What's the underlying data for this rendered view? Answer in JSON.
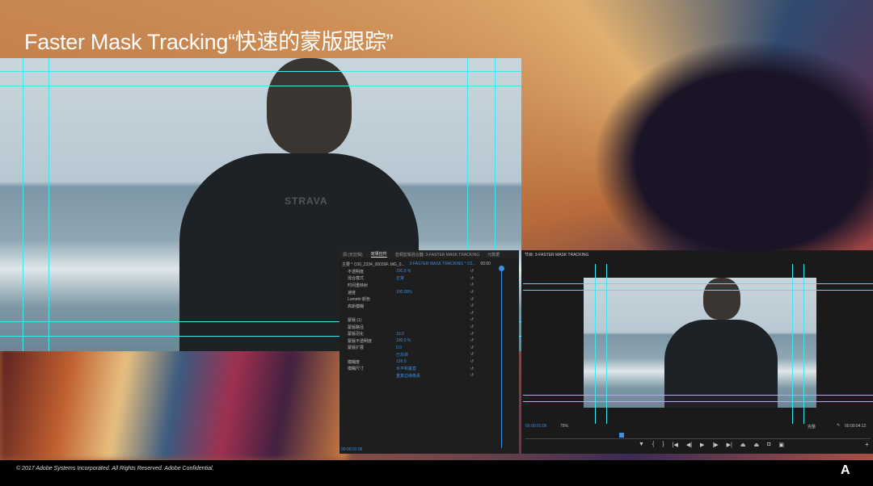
{
  "slide": {
    "title": "Faster Mask Tracking“快速的蒙版跟踪”"
  },
  "effect_controls": {
    "tabs": [
      "源:(无剪辑)",
      "效果控件",
      "音频剪辑混合器: 3-FASTER MASK TRACKING",
      "元数据"
    ],
    "clip_source": "主要 * C00_2334_00039F..MG_0...",
    "clip_target": "3-FASTER MASK TRACKING * C0...",
    "time": "00:00",
    "rows": [
      {
        "label": "不透明度",
        "value": "100.0 %"
      },
      {
        "label": "混合模式",
        "value": "正常"
      },
      {
        "label": "时间重映射",
        "value": ""
      },
      {
        "label": "速度",
        "value": "100.00%"
      },
      {
        "label": "Lumetri 颜色",
        "value": ""
      },
      {
        "label": "高斯模糊",
        "value": ""
      },
      {
        "label": "",
        "value": ""
      },
      {
        "label": "蒙版 (1)",
        "value": ""
      },
      {
        "label": "蒙版路径",
        "value": ""
      },
      {
        "label": "蒙版羽化",
        "value": "10.0"
      },
      {
        "label": "蒙版不透明度",
        "value": "100.0 %"
      },
      {
        "label": "蒙版扩展",
        "value": "0.0"
      },
      {
        "label": "",
        "value": "已反转"
      },
      {
        "label": "模糊度",
        "value": "126.0"
      },
      {
        "label": "模糊尺寸",
        "value": "水平和垂直"
      },
      {
        "label": "",
        "value": "重复边缘像素"
      }
    ],
    "bottom_time": "00:00:01:06"
  },
  "program_monitor": {
    "title": "节目: 3-FASTER MASK TRACKING",
    "timecode": "00:00:01:06",
    "zoom": "75%",
    "quality": "完整",
    "duration": "00:00:04:12",
    "shirt_text": "STRAVA"
  },
  "footer": {
    "copyright": "© 2017 Adobe Systems Incorporated.  All Rights Reserved.  Adobe Confidential.",
    "logo": "Adobe"
  },
  "colors": {
    "guide": "#3ee6f0",
    "accent": "#3a8ee6"
  }
}
